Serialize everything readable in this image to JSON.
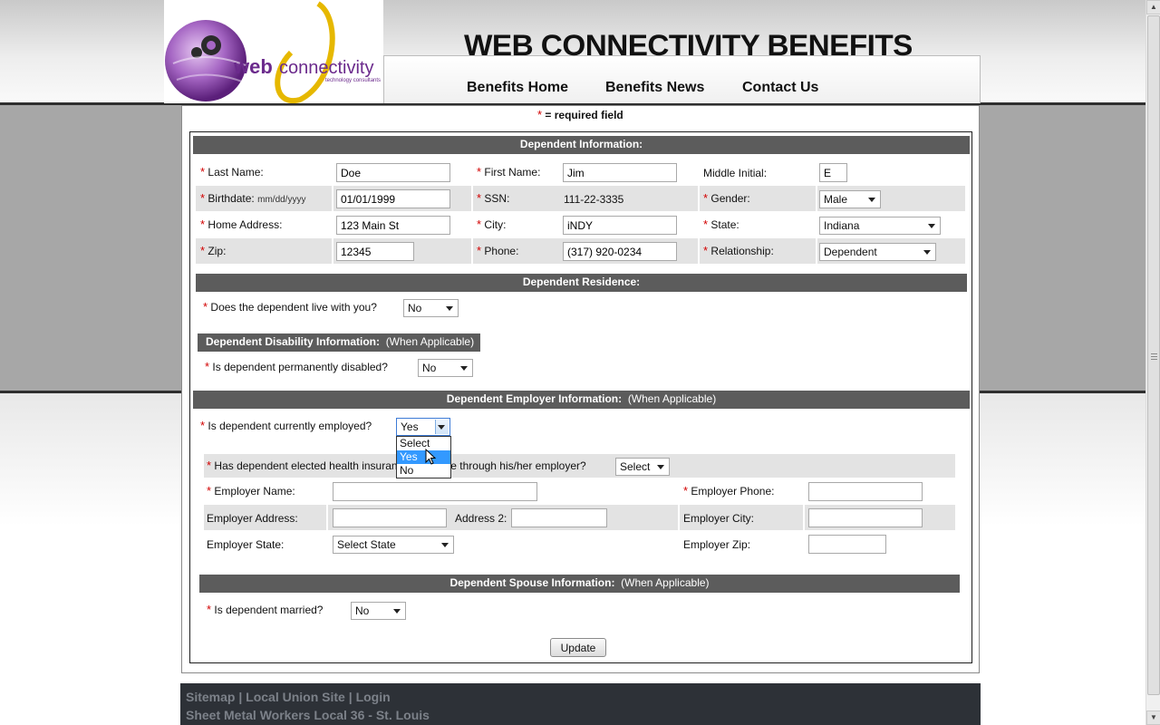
{
  "header": {
    "logo_word_a": "web",
    "logo_word_b": "connectivity",
    "logo_tagline": "technology consultants",
    "site_title": "WEB CONNECTIVITY BENEFITS",
    "nav": [
      "Benefits Home",
      "Benefits News",
      "Contact Us"
    ]
  },
  "form": {
    "required_note": "= required field",
    "required_marker": "*",
    "dependent_info": {
      "heading": "Dependent Information:",
      "last_name_label": "Last Name:",
      "last_name": "Doe",
      "first_name_label": "First Name:",
      "first_name": "Jim",
      "middle_initial_label": "Middle Initial:",
      "middle_initial": "E",
      "birthdate_label": "Birthdate:",
      "birthdate_hint": "mm/dd/yyyy",
      "birthdate": "01/01/1999",
      "ssn_label": "SSN:",
      "ssn": "111-22-3335",
      "gender_label": "Gender:",
      "gender": "Male",
      "home_address_label": "Home Address:",
      "home_address": "123 Main St",
      "city_label": "City:",
      "city": "iNDY",
      "state_label": "State:",
      "state": "Indiana",
      "zip_label": "Zip:",
      "zip": "12345",
      "phone_label": "Phone:",
      "phone": "(317) 920-0234",
      "relationship_label": "Relationship:",
      "relationship": "Dependent"
    },
    "residence": {
      "heading": "Dependent Residence:",
      "live_with_label": "Does the dependent live with you?",
      "live_with": "No"
    },
    "disability": {
      "heading": "Dependent Disability Information:",
      "heading_note": "(When Applicable)",
      "disabled_label": "Is dependent permanently disabled?",
      "disabled": "No"
    },
    "employer": {
      "heading": "Dependent Employer Information:",
      "heading_note": "(When Applicable)",
      "employed_label": "Is dependent currently employed?",
      "employed": "Yes",
      "employed_options": [
        "Select",
        "Yes",
        "No"
      ],
      "elected_label": "Has dependent elected health insurance coverage through his/her employer?",
      "elected": "Select",
      "employer_name_label": "Employer Name:",
      "employer_name": "",
      "employer_phone_label": "Employer Phone:",
      "employer_phone": "",
      "employer_address_label": "Employer Address:",
      "employer_address": "",
      "address2_label": "Address 2:",
      "address2": "",
      "employer_city_label": "Employer City:",
      "employer_city": "",
      "employer_state_label": "Employer State:",
      "employer_state": "Select State",
      "employer_zip_label": "Employer Zip:",
      "employer_zip": ""
    },
    "spouse": {
      "heading": "Dependent Spouse Information:",
      "heading_note": "(When Applicable)",
      "married_label": "Is dependent married?",
      "married": "No"
    },
    "update_button": "Update"
  },
  "footer": {
    "links": [
      "Sitemap",
      "Local Union Site",
      "Login"
    ],
    "separator": "|",
    "org": "Sheet Metal Workers Local 36 - St. Louis"
  },
  "colors": {
    "section_bar": "#5c5c5c",
    "required": "#d20000",
    "highlight": "#3399ff",
    "footer_bg": "#2d3137",
    "logo_purple": "#8a3fa8",
    "logo_gold": "#e6b800"
  }
}
